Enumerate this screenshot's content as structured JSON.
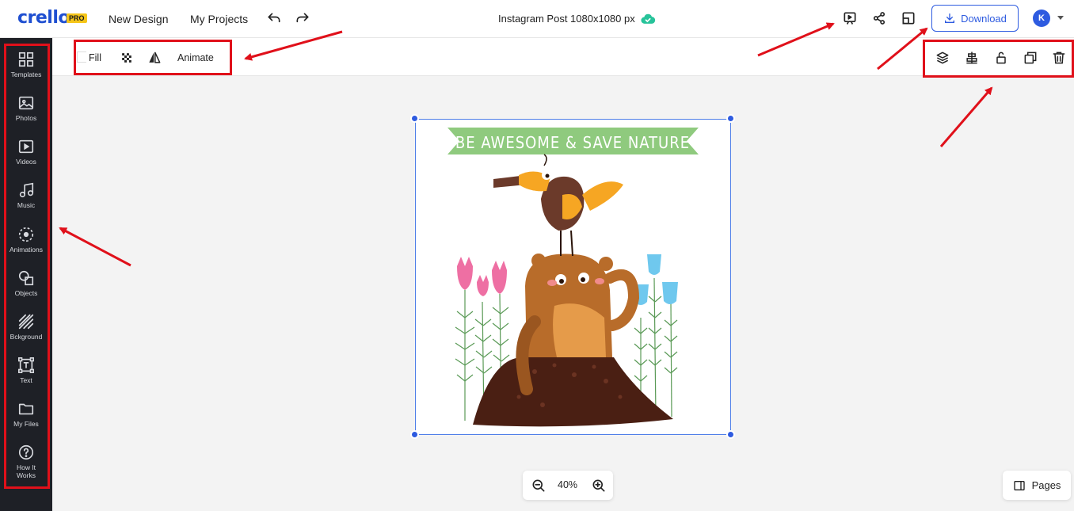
{
  "brand": {
    "logo": "crello",
    "badge": "PRO",
    "accent": "#2e5be0"
  },
  "topbar": {
    "new_design": "New Design",
    "my_projects": "My Projects",
    "doc_title": "Instagram Post 1080x1080 px",
    "download_label": "Download",
    "avatar_initial": "K"
  },
  "sidebar": {
    "items": [
      {
        "label": "Templates",
        "icon": "templates-icon"
      },
      {
        "label": "Photos",
        "icon": "photos-icon"
      },
      {
        "label": "Videos",
        "icon": "videos-icon"
      },
      {
        "label": "Music",
        "icon": "music-icon"
      },
      {
        "label": "Animations",
        "icon": "animations-icon"
      },
      {
        "label": "Objects",
        "icon": "objects-icon"
      },
      {
        "label": "Bckground",
        "icon": "background-icon"
      },
      {
        "label": "Text",
        "icon": "text-icon"
      },
      {
        "label": "My Files",
        "icon": "folder-icon"
      },
      {
        "label": "How It Works",
        "icon": "help-icon"
      }
    ]
  },
  "toolbar": {
    "fill_label": "Fill",
    "animate_label": "Animate"
  },
  "canvas": {
    "banner_text": "BE AWESOME & SAVE NATURE"
  },
  "zoom": {
    "value": "40%"
  },
  "pages": {
    "label": "Pages"
  },
  "annotation_color": "#e0101a"
}
